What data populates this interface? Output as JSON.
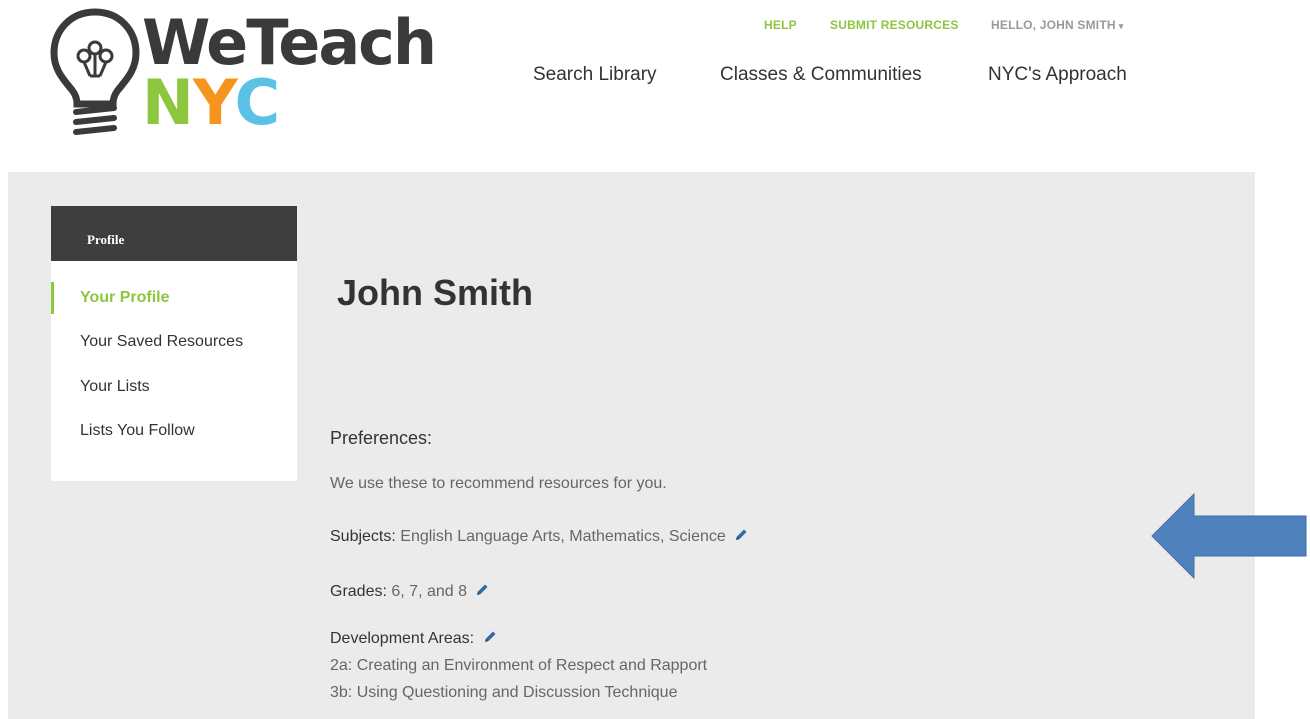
{
  "brand": {
    "name_top": "WeTeach",
    "name_bottom": [
      "N",
      "Y",
      "C"
    ],
    "colors": {
      "n": "#8dc63f",
      "y": "#f7941d",
      "c": "#5bc2e7",
      "dark": "#3a3a3a"
    }
  },
  "utility_nav": {
    "help": "HELP",
    "submit": "SUBMIT RESOURCES",
    "user": "HELLO, JOHN SMITH",
    "user_caret": "▾"
  },
  "main_nav": {
    "search": "Search Library",
    "classes": "Classes & Communities",
    "approach": "NYC's Approach"
  },
  "sidebar": {
    "heading": "Profile",
    "items": [
      {
        "label": "Your Profile",
        "active": true
      },
      {
        "label": "Your Saved Resources",
        "active": false
      },
      {
        "label": "Your Lists",
        "active": false
      },
      {
        "label": "Lists You Follow",
        "active": false
      }
    ]
  },
  "profile": {
    "name": "John Smith",
    "preferences_heading": "Preferences:",
    "preferences_description": "We use these to recommend resources for you.",
    "subjects_label": "Subjects:",
    "subjects_value": "English Language Arts, Mathematics, Science",
    "grades_label": "Grades:",
    "grades_value": "6, 7, and 8",
    "development_label": "Development Areas:",
    "development_areas": [
      "2a: Creating an Environment of Respect and Rapport",
      "3b: Using Questioning and Discussion Technique"
    ]
  },
  "icons": {
    "edit": "pencil-icon",
    "annotation": "arrow-left-icon"
  },
  "accent_colors": {
    "green": "#8dc63f",
    "edit_blue": "#2e6da4",
    "arrow_blue": "#4f81bd"
  }
}
